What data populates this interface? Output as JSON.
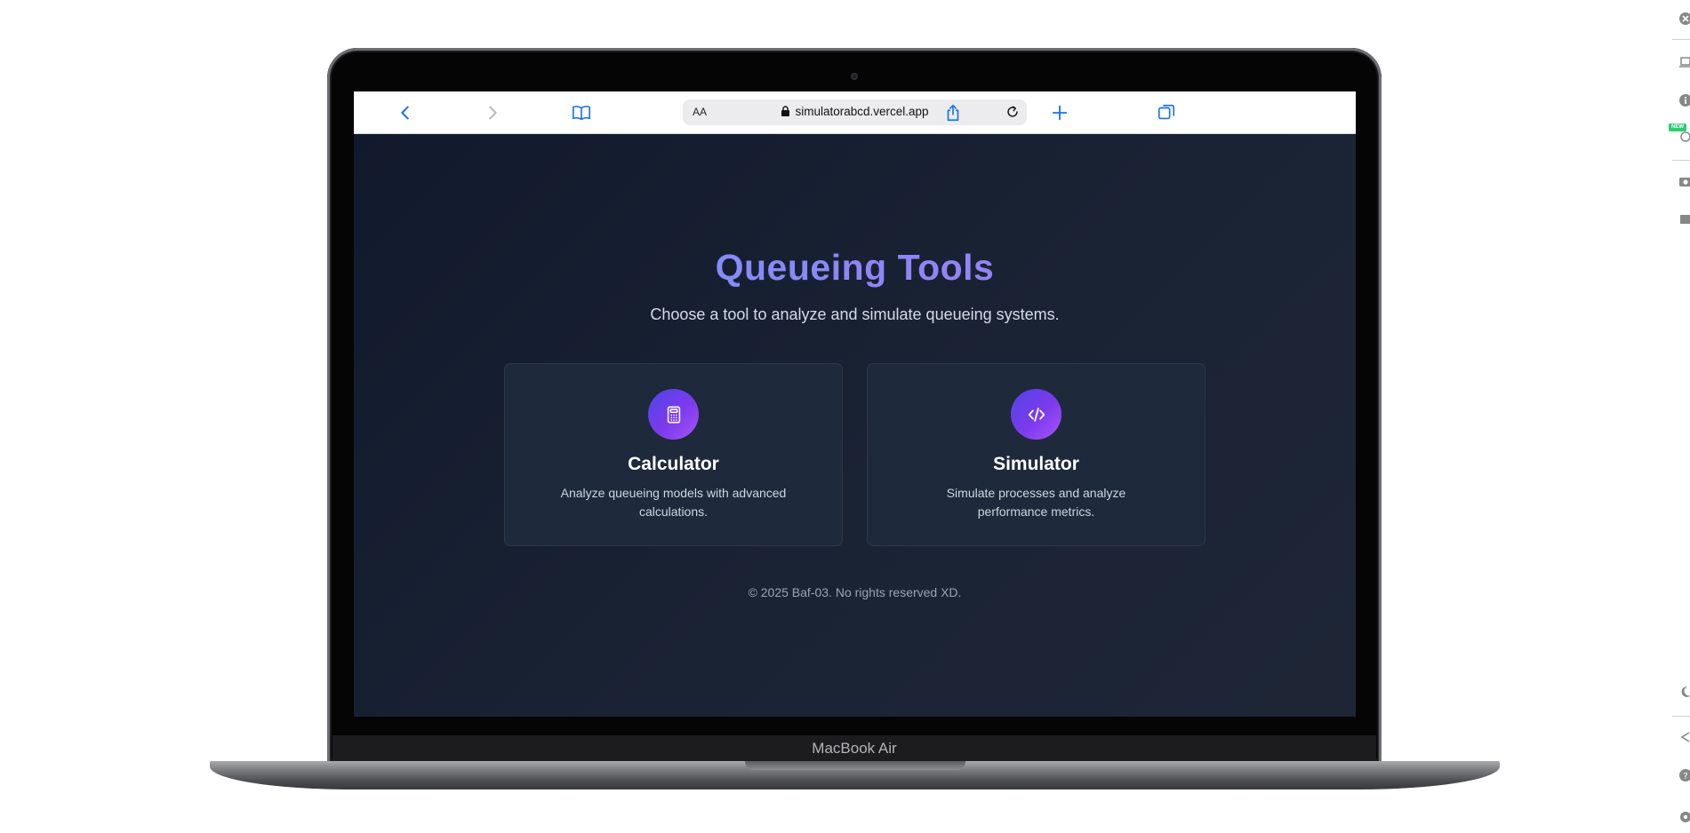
{
  "laptop": {
    "model_label": "MacBook Air"
  },
  "browser": {
    "reader_label": "AA",
    "url": "simulatorabcd.vercel.app",
    "accent_color": "#1a73e8"
  },
  "page": {
    "title": "Queueing Tools",
    "subtitle": "Choose a tool to analyze and simulate queueing systems.",
    "cards": [
      {
        "title": "Calculator",
        "description": "Analyze queueing models with advanced calculations.",
        "icon": "calculator-icon"
      },
      {
        "title": "Simulator",
        "description": "Simulate processes and analyze performance metrics.",
        "icon": "code-icon"
      }
    ],
    "footer": "© 2025 Baf-03. No rights reserved XD.",
    "colors": {
      "background": "#0f172a",
      "card": "#1e293b",
      "gradient_start": "#6d9cf8",
      "gradient_end": "#a77cf3"
    }
  },
  "extension_toolbar": {
    "items": [
      "close-icon",
      "laptop-icon",
      "info-icon",
      "new-feature-icon",
      "camera-icon",
      "record-icon",
      "moon-icon",
      "share-icon",
      "help-icon",
      "settings-icon"
    ],
    "badge": "NEW"
  }
}
